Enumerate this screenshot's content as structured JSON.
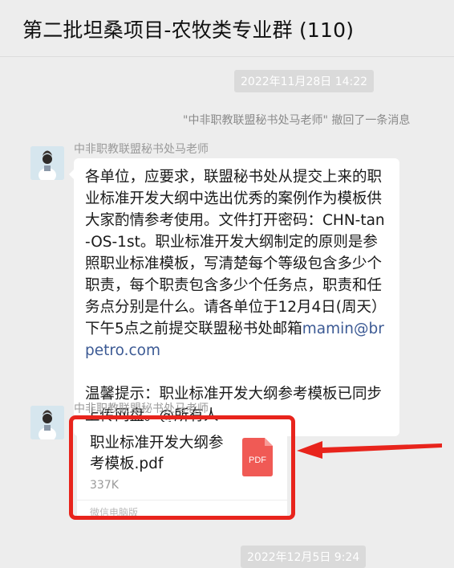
{
  "header": {
    "title": "第二批坦桑项目-农牧类专业群 (110)"
  },
  "timestamps": [
    "2022年11月28日 14:22",
    "2022年12月5日 9:24"
  ],
  "recall_notice": "\"中非职教联盟秘书处马老师\" 撤回了一条消息",
  "messages": [
    {
      "sender": "中非职教联盟秘书处马老师",
      "text_main": "各单位，应要求，联盟秘书处从提交上来的职业标准开发大纲中选出优秀的案例作为模板供大家酌情参考使用。文件打开密码：CHN-tan-OS-1st。职业标准开发大纲制定的原则是参照职业标准模板，写清楚每个等级包含多少个职责，每个职责包含多少个任务点，职责和任务点分别是什么。请各单位于12月4日(周天）下午5点之前提交联盟秘书处邮箱",
      "email": "mamin@brpetro.com",
      "text_tip": "温馨提示：职业标准开发大纲参考模板已同步上传网盘。@所有人"
    },
    {
      "sender": "中非职教联盟秘书处马老师",
      "file": {
        "name": "职业标准开发大纲参考模板.pdf",
        "size": "337K",
        "source": "微信电脑版",
        "icon_label": "PDF",
        "icon": "pdf-file-icon"
      }
    }
  ],
  "colors": {
    "background": "#ededed",
    "bubble": "#ffffff",
    "pdf_icon": "#f05a55",
    "annotation": "#e8241c",
    "link": "#3c5a94"
  }
}
